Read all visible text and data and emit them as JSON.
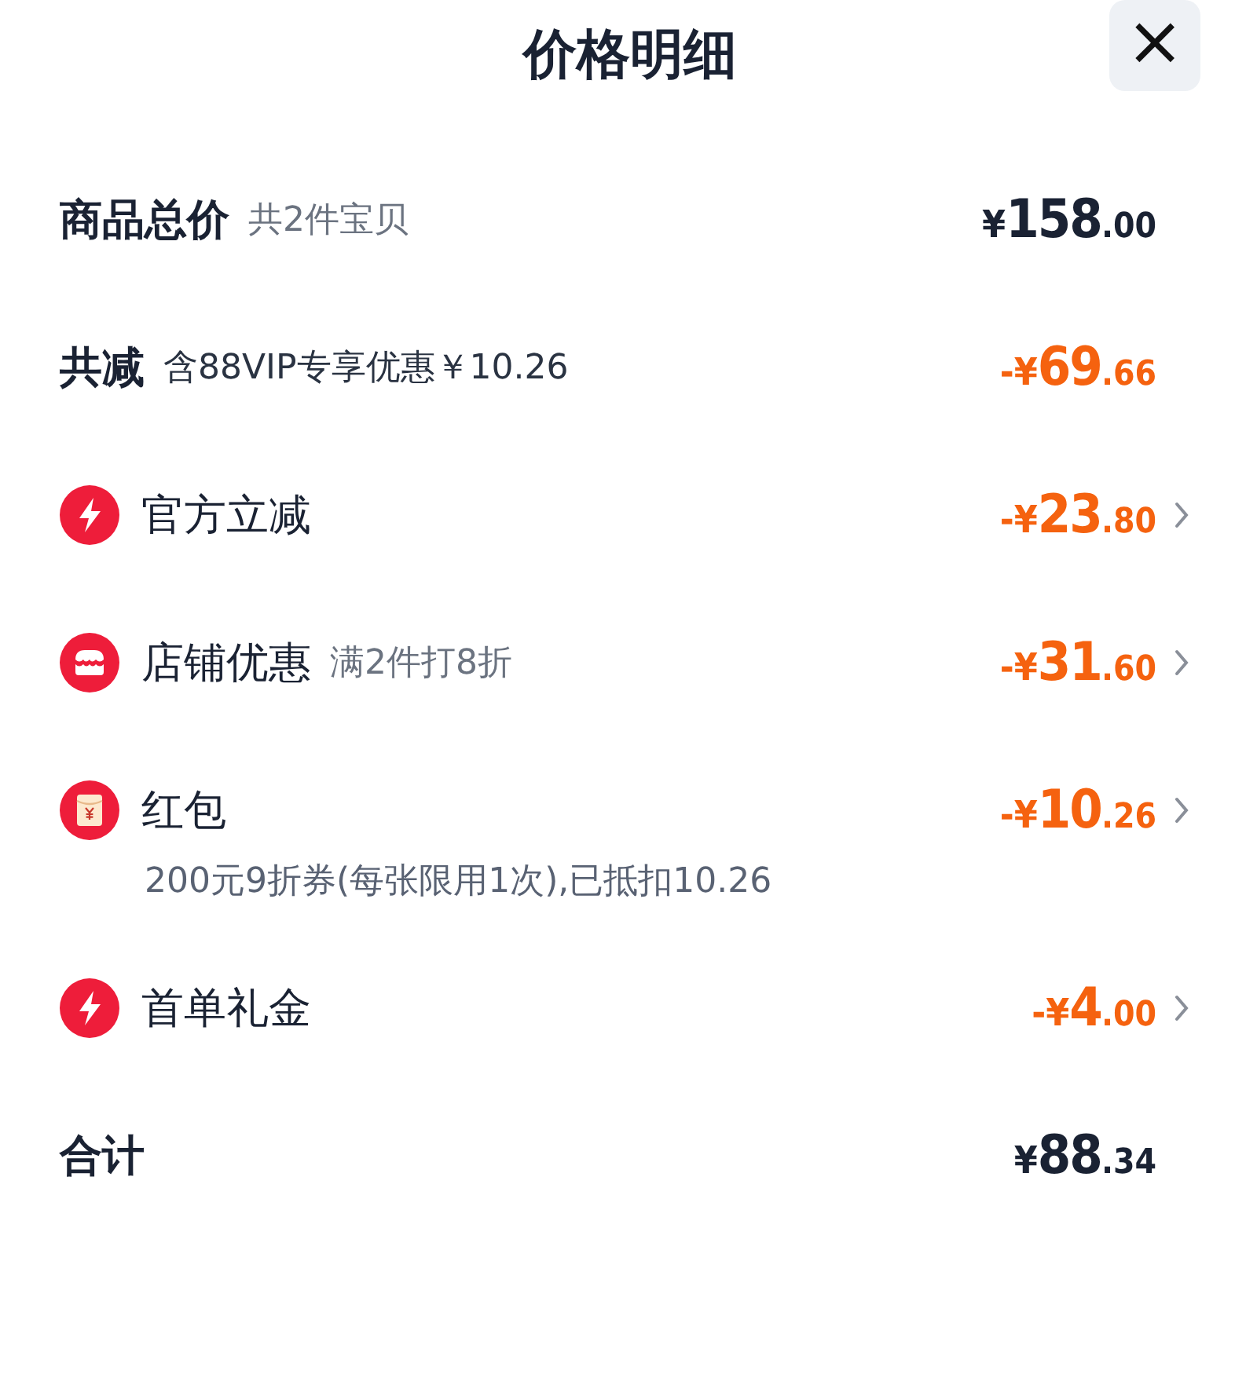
{
  "title": "价格明细",
  "close_button": "×",
  "rows": [
    {
      "kind": "subtotal",
      "label": "商品总价",
      "note": "共2件宝贝",
      "amount": {
        "sign": "¥",
        "whole": "158",
        "fraction": ".00"
      }
    },
    {
      "kind": "reduction",
      "label": "共减",
      "note": "含88VIP专享优惠￥10.26",
      "amount": {
        "sign": "-¥",
        "whole": "69",
        "fraction": ".66"
      }
    },
    {
      "kind": "discount",
      "icon": {
        "kind": "bolt"
      },
      "label": "官方立减",
      "amount": {
        "sign": "-¥",
        "whole": "23",
        "fraction": ".80"
      }
    },
    {
      "kind": "discount",
      "icon": {
        "kind": "shop"
      },
      "label": "店铺优惠",
      "note": "满2件打8折",
      "amount": {
        "sign": "-¥",
        "whole": "31",
        "fraction": ".60"
      }
    },
    {
      "kind": "discount",
      "icon": {
        "kind": "packet"
      },
      "label": "红包",
      "detail": "200元9折券(每张限用1次),已抵扣10.26",
      "amount": {
        "sign": "-¥",
        "whole": "10",
        "fraction": ".26"
      }
    },
    {
      "kind": "discount",
      "icon": {
        "kind": "bolt"
      },
      "label": "首单礼金",
      "amount": {
        "sign": "-¥",
        "whole": "4",
        "fraction": ".00"
      }
    },
    {
      "kind": "total",
      "label": "合计",
      "amount": {
        "sign": "¥",
        "whole": "88",
        "fraction": ".34"
      }
    }
  ]
}
